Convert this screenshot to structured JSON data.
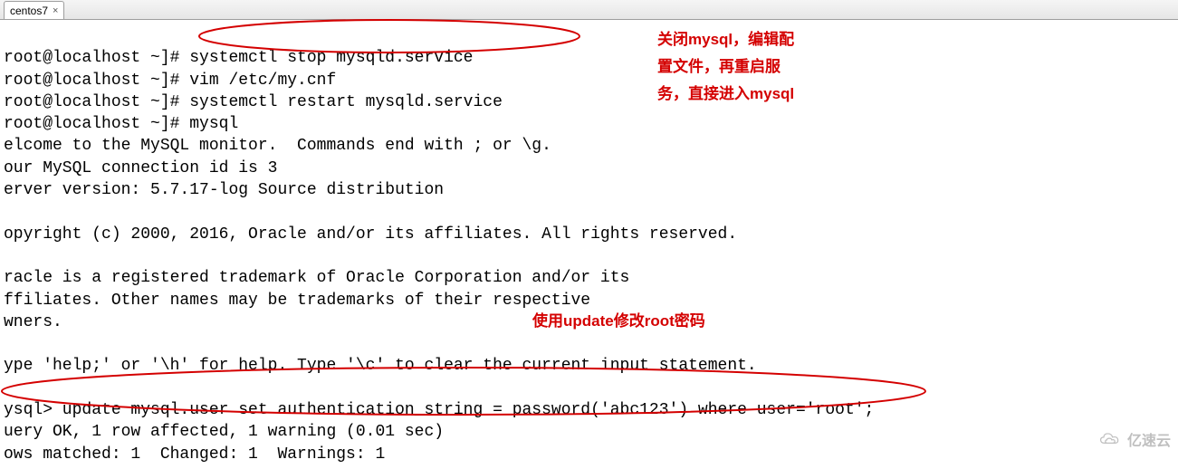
{
  "tab": {
    "title": "centos7",
    "close": "×"
  },
  "terminal": {
    "l0": "root@localhost ~]# systemctl stop mysqld.service",
    "l1": "root@localhost ~]# vim /etc/my.cnf",
    "l2": "root@localhost ~]# systemctl restart mysqld.service",
    "l3": "root@localhost ~]# mysql",
    "l4": "elcome to the MySQL monitor.  Commands end with ; or \\g.",
    "l5": "our MySQL connection id is 3",
    "l6": "erver version: 5.7.17-log Source distribution",
    "l7": "",
    "l8": "opyright (c) 2000, 2016, Oracle and/or its affiliates. All rights reserved.",
    "l9": "",
    "l10": "racle is a registered trademark of Oracle Corporation and/or its",
    "l11": "ffiliates. Other names may be trademarks of their respective",
    "l12": "wners.",
    "l13": "",
    "l14": "ype 'help;' or '\\h' for help. Type '\\c' to clear the current input statement.",
    "l15": "",
    "l16": "ysql> update mysql.user set authentication_string = password('abc123') where user='root';",
    "l17": "uery OK, 1 row affected, 1 warning (0.01 sec)",
    "l18": "ows matched: 1  Changed: 1  Warnings: 1"
  },
  "annotations": {
    "a1_line1": "关闭mysql，编辑配",
    "a1_line2": "置文件，再重启服",
    "a1_line3": "务，直接进入mysql",
    "a2": "使用update修改root密码"
  },
  "watermark": {
    "text": "亿速云"
  }
}
